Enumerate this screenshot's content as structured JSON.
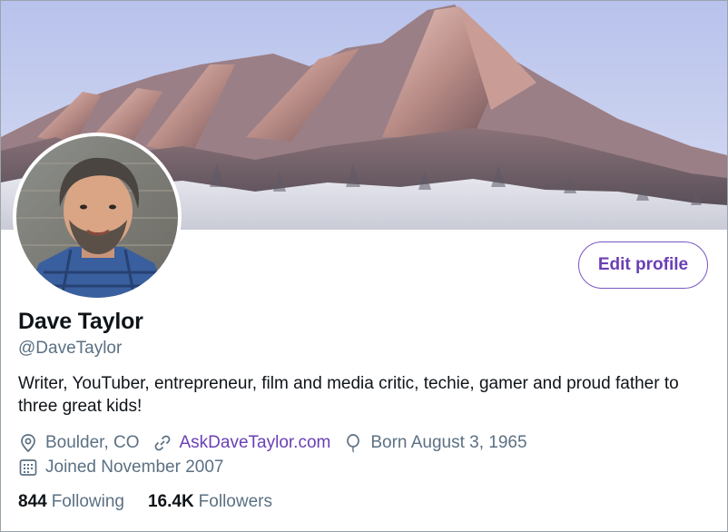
{
  "profile": {
    "name": "Dave Taylor",
    "handle": "@DaveTaylor",
    "bio": "Writer, YouTuber, entrepreneur, film and media critic, techie, gamer and proud father to three great kids!",
    "location": "Boulder, CO",
    "website": "AskDaveTaylor.com",
    "birthday": "Born August 3, 1965",
    "joined": "Joined November 2007"
  },
  "actions": {
    "edit_profile_label": "Edit profile"
  },
  "stats": {
    "following_count": "844",
    "following_label": "Following",
    "followers_count": "16.4K",
    "followers_label": "Followers"
  },
  "icons": {
    "location": "location-pin-icon",
    "website": "link-icon",
    "birthday": "balloon-icon",
    "joined": "calendar-icon"
  },
  "colors": {
    "accent": "#6a3fb5",
    "secondary_text": "#5b7083",
    "primary_text": "#0f1419"
  }
}
